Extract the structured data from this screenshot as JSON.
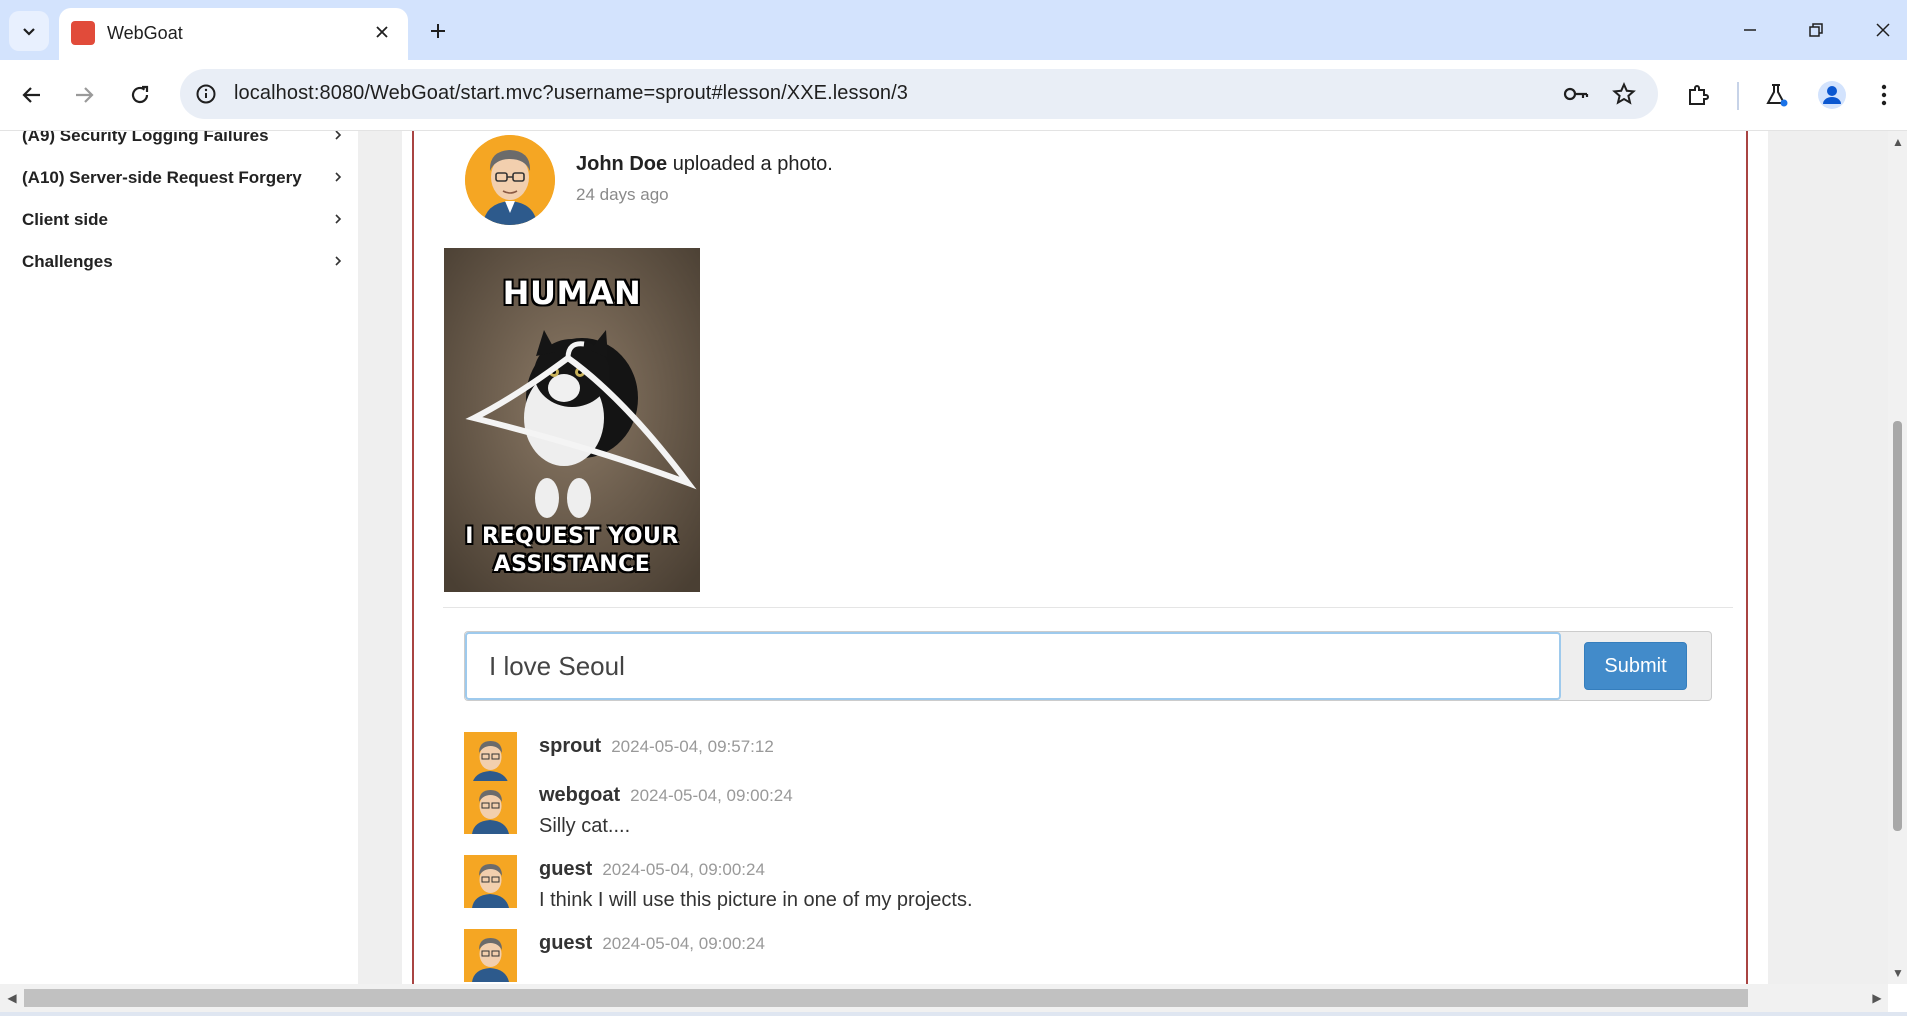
{
  "browser": {
    "tab_title": "WebGoat",
    "url": "localhost:8080/WebGoat/start.mvc?username=sprout#lesson/XXE.lesson/3",
    "favicon": "webgoat-icon",
    "accent_color": "#d3e3fd"
  },
  "sidebar": {
    "items": [
      {
        "label": "(A9) Security Logging Failures"
      },
      {
        "label": "(A10) Server-side Request Forgery"
      },
      {
        "label": "Client side"
      },
      {
        "label": "Challenges"
      }
    ]
  },
  "post": {
    "author": "John Doe",
    "action": "uploaded a photo.",
    "time": "24 days ago",
    "photo_caption_top": "HUMAN",
    "photo_caption_bottom_1": "I REQUEST YOUR",
    "photo_caption_bottom_2": "ASSISTANCE"
  },
  "comment_form": {
    "value": "I love Seoul",
    "submit_label": "Submit"
  },
  "comments": [
    {
      "user": "sprout",
      "date": "2024-05-04, 09:57:12",
      "text": ""
    },
    {
      "user": "webgoat",
      "date": "2024-05-04, 09:00:24",
      "text": "Silly cat...."
    },
    {
      "user": "guest",
      "date": "2024-05-04, 09:00:24",
      "text": "I think I will use this picture in one of my projects."
    },
    {
      "user": "guest",
      "date": "2024-05-04, 09:00:24",
      "text": ""
    }
  ]
}
